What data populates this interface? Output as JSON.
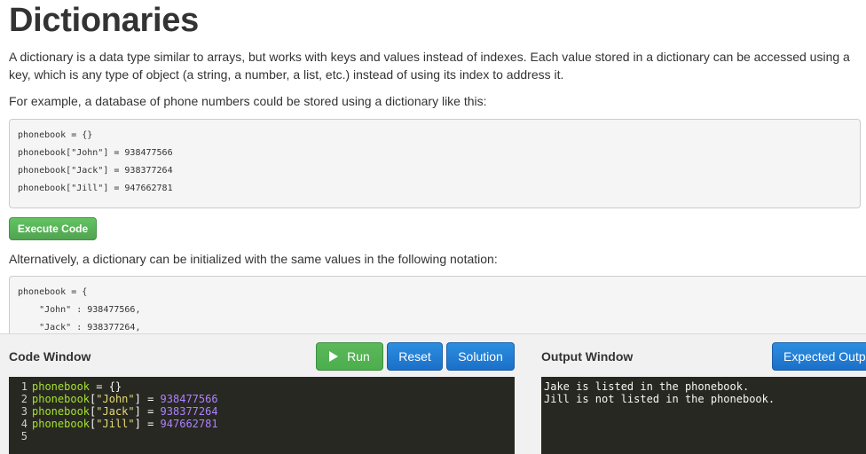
{
  "article": {
    "title": "Dictionaries",
    "paragraph1": "A dictionary is a data type similar to arrays, but works with keys and values instead of indexes. Each value stored in a dictionary can be accessed using a key, which is any type of object (a string, a number, a list, etc.) instead of using its index to address it.",
    "paragraph2": "For example, a database of phone numbers could be stored using a dictionary like this:",
    "code1": [
      "phonebook = {}",
      "phonebook[\"John\"] = 938477566",
      "phonebook[\"Jack\"] = 938377264",
      "phonebook[\"Jill\"] = 947662781"
    ],
    "execute_label": "Execute Code",
    "paragraph3": "Alternatively, a dictionary can be initialized with the same values in the following notation:",
    "code2": [
      "phonebook = {",
      "    \"John\" : 938477566,",
      "    \"Jack\" : 938377264,"
    ]
  },
  "code_window": {
    "title": "Code Window",
    "run_label": "Run",
    "reset_label": "Reset",
    "solution_label": "Solution",
    "lines": [
      {
        "num": "1",
        "name": "phonebook",
        "rest": " = {}",
        "key": "",
        "value": ""
      },
      {
        "num": "2",
        "name": "phonebook",
        "rest": " = ",
        "key": "\"John\"",
        "value": "938477566"
      },
      {
        "num": "3",
        "name": "phonebook",
        "rest": " = ",
        "key": "\"Jack\"",
        "value": "938377264"
      },
      {
        "num": "4",
        "name": "phonebook",
        "rest": " = ",
        "key": "\"Jill\"",
        "value": "947662781"
      },
      {
        "num": "5",
        "name": "",
        "rest": "",
        "key": "",
        "value": ""
      }
    ]
  },
  "output_window": {
    "title": "Output Window",
    "expected_label": "Expected Output",
    "lines": [
      "Jake is listed in the phonebook.",
      "Jill is not listed in the phonebook."
    ]
  },
  "colors": {
    "editor_bg": "#272822",
    "run_green": "#5cb85c",
    "button_blue": "#1b6fc8"
  }
}
